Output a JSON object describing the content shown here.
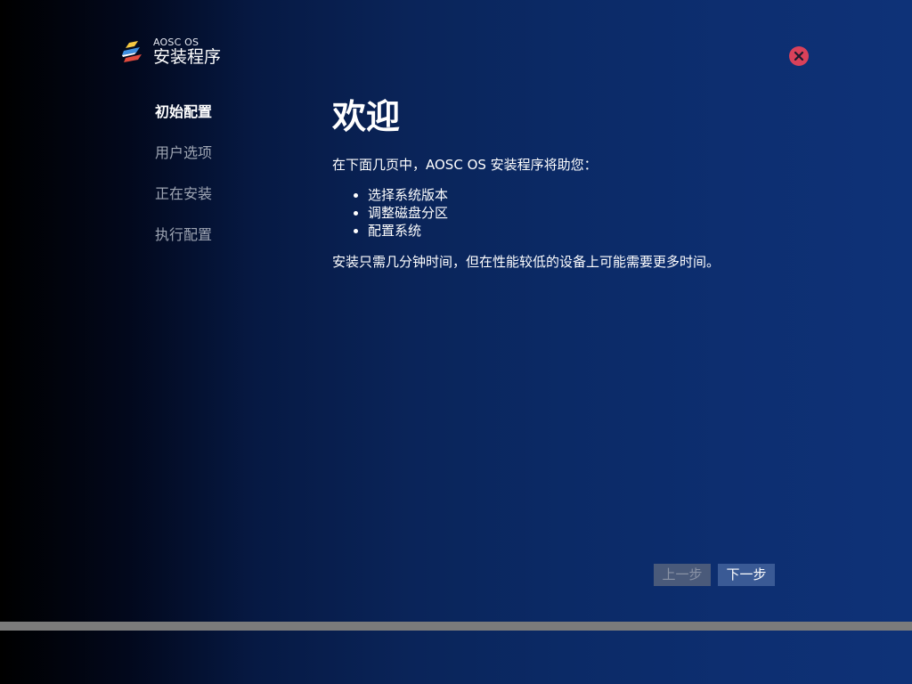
{
  "header": {
    "os_name": "AOSC OS",
    "title": "安装程序"
  },
  "steps": [
    {
      "label": "初始配置",
      "active": true
    },
    {
      "label": "用户选项",
      "active": false
    },
    {
      "label": "正在安装",
      "active": false
    },
    {
      "label": "执行配置",
      "active": false
    }
  ],
  "main": {
    "heading": "欢迎",
    "intro": "在下面几页中，AOSC OS 安装程序将助您：",
    "bullets": [
      "选择系统版本",
      "调整磁盘分区",
      "配置系统"
    ],
    "note": "安装只需几分钟时间，但在性能较低的设备上可能需要更多时间。"
  },
  "buttons": {
    "prev": "上一步",
    "next": "下一步"
  },
  "progress": {
    "fraction": 0
  },
  "colors": {
    "close": "#d9415a",
    "active_step": "#ffffff",
    "inactive_step": "#9ea5b3",
    "next_button": "#3a5a95",
    "prev_button": "#4a5a7a"
  },
  "icons": {
    "logo": "aosc-logo-icon",
    "close": "close-icon"
  }
}
